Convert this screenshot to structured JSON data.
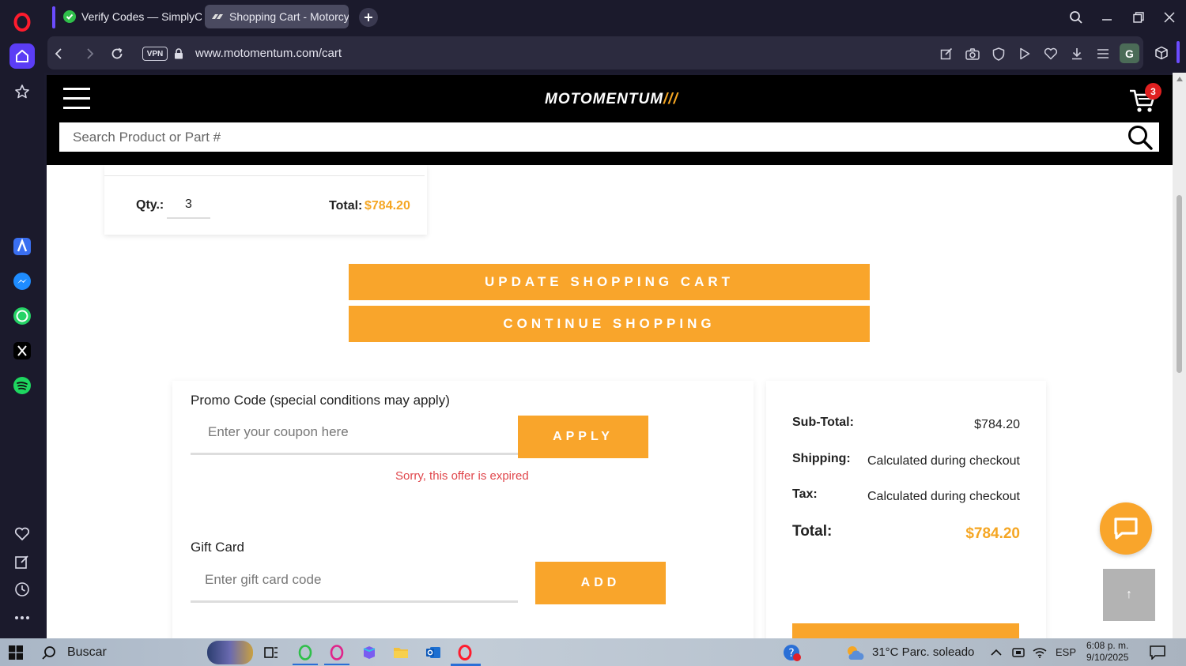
{
  "browser": {
    "tabs": [
      {
        "label": "Verify Codes — SimplyCo",
        "active": false
      },
      {
        "label": "Shopping Cart - Motorcyc",
        "active": true
      }
    ],
    "vpn_label": "VPN",
    "url": "www.motomentum.com/cart",
    "profile_initial": "G"
  },
  "site": {
    "logo_text": "MOTOMENTUM",
    "logo_slashes": "///",
    "cart_count": "3",
    "search_placeholder": "Search Product or Part #"
  },
  "cart_item": {
    "qty_label": "Qty.:",
    "qty_value": "3",
    "total_label": "Total:",
    "total_value": "$784.20"
  },
  "actions": {
    "update_label": "UPDATE SHOPPING CART",
    "continue_label": "CONTINUE SHOPPING"
  },
  "promo": {
    "title": "Promo Code (special conditions may apply)",
    "coupon_placeholder": "Enter your coupon here",
    "apply_label": "APPLY",
    "error_text": "Sorry, this offer is expired",
    "gift_title": "Gift Card",
    "gift_placeholder": "Enter gift card code",
    "add_label": "ADD"
  },
  "summary": {
    "subtotal_label": "Sub-Total:",
    "subtotal_value": "$784.20",
    "shipping_label": "Shipping:",
    "shipping_value": "Calculated during checkout",
    "tax_label": "Tax:",
    "tax_value": "Calculated during checkout",
    "total_label": "Total:",
    "total_value": "$784.20"
  },
  "page_controls": {
    "back_to_top_glyph": "↑"
  },
  "taskbar": {
    "search_label": "Buscar",
    "weather": "31°C  Parc. soleado",
    "language": "ESP",
    "time": "6:08 p. m.",
    "date": "9/10/2025"
  },
  "colors": {
    "accent": "#f9a52b",
    "error": "#e0474c",
    "price": "#f5a623"
  }
}
